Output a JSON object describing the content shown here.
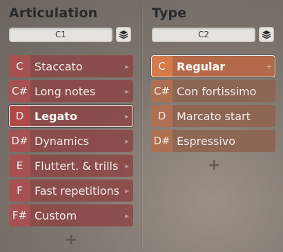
{
  "articulation": {
    "title": "Articulation",
    "key_range": "C1",
    "add_label": "+",
    "items": [
      {
        "key": "C",
        "label": "Staccato",
        "selected": false,
        "indicator": "▸"
      },
      {
        "key": "C#",
        "label": "Long notes",
        "selected": false,
        "indicator": "▸"
      },
      {
        "key": "D",
        "label": "Legato",
        "selected": true,
        "indicator": "▸"
      },
      {
        "key": "D#",
        "label": "Dynamics",
        "selected": false,
        "indicator": "▸"
      },
      {
        "key": "E",
        "label": "Fluttert. & trills",
        "selected": false,
        "indicator": "▸"
      },
      {
        "key": "F",
        "label": "Fast repetitions",
        "selected": false,
        "indicator": "▸"
      },
      {
        "key": "F#",
        "label": "Custom",
        "selected": false,
        "indicator": "▸"
      }
    ]
  },
  "type": {
    "title": "Type",
    "key_range": "C2",
    "add_label": "+",
    "items": [
      {
        "key": "C",
        "label": "Regular",
        "selected": true,
        "indicator": "+"
      },
      {
        "key": "C#",
        "label": "Con fortissimo",
        "selected": false,
        "indicator": ""
      },
      {
        "key": "D",
        "label": "Marcato start",
        "selected": false,
        "indicator": ""
      },
      {
        "key": "D#",
        "label": "Espressivo",
        "selected": false,
        "indicator": ""
      }
    ]
  },
  "icons": {
    "layers": "layers-icon",
    "arrow": "chevron-right-icon",
    "add": "plus-icon"
  },
  "colors": {
    "articulation_accent": "#b04848",
    "type_accent": "#d57a4a"
  }
}
